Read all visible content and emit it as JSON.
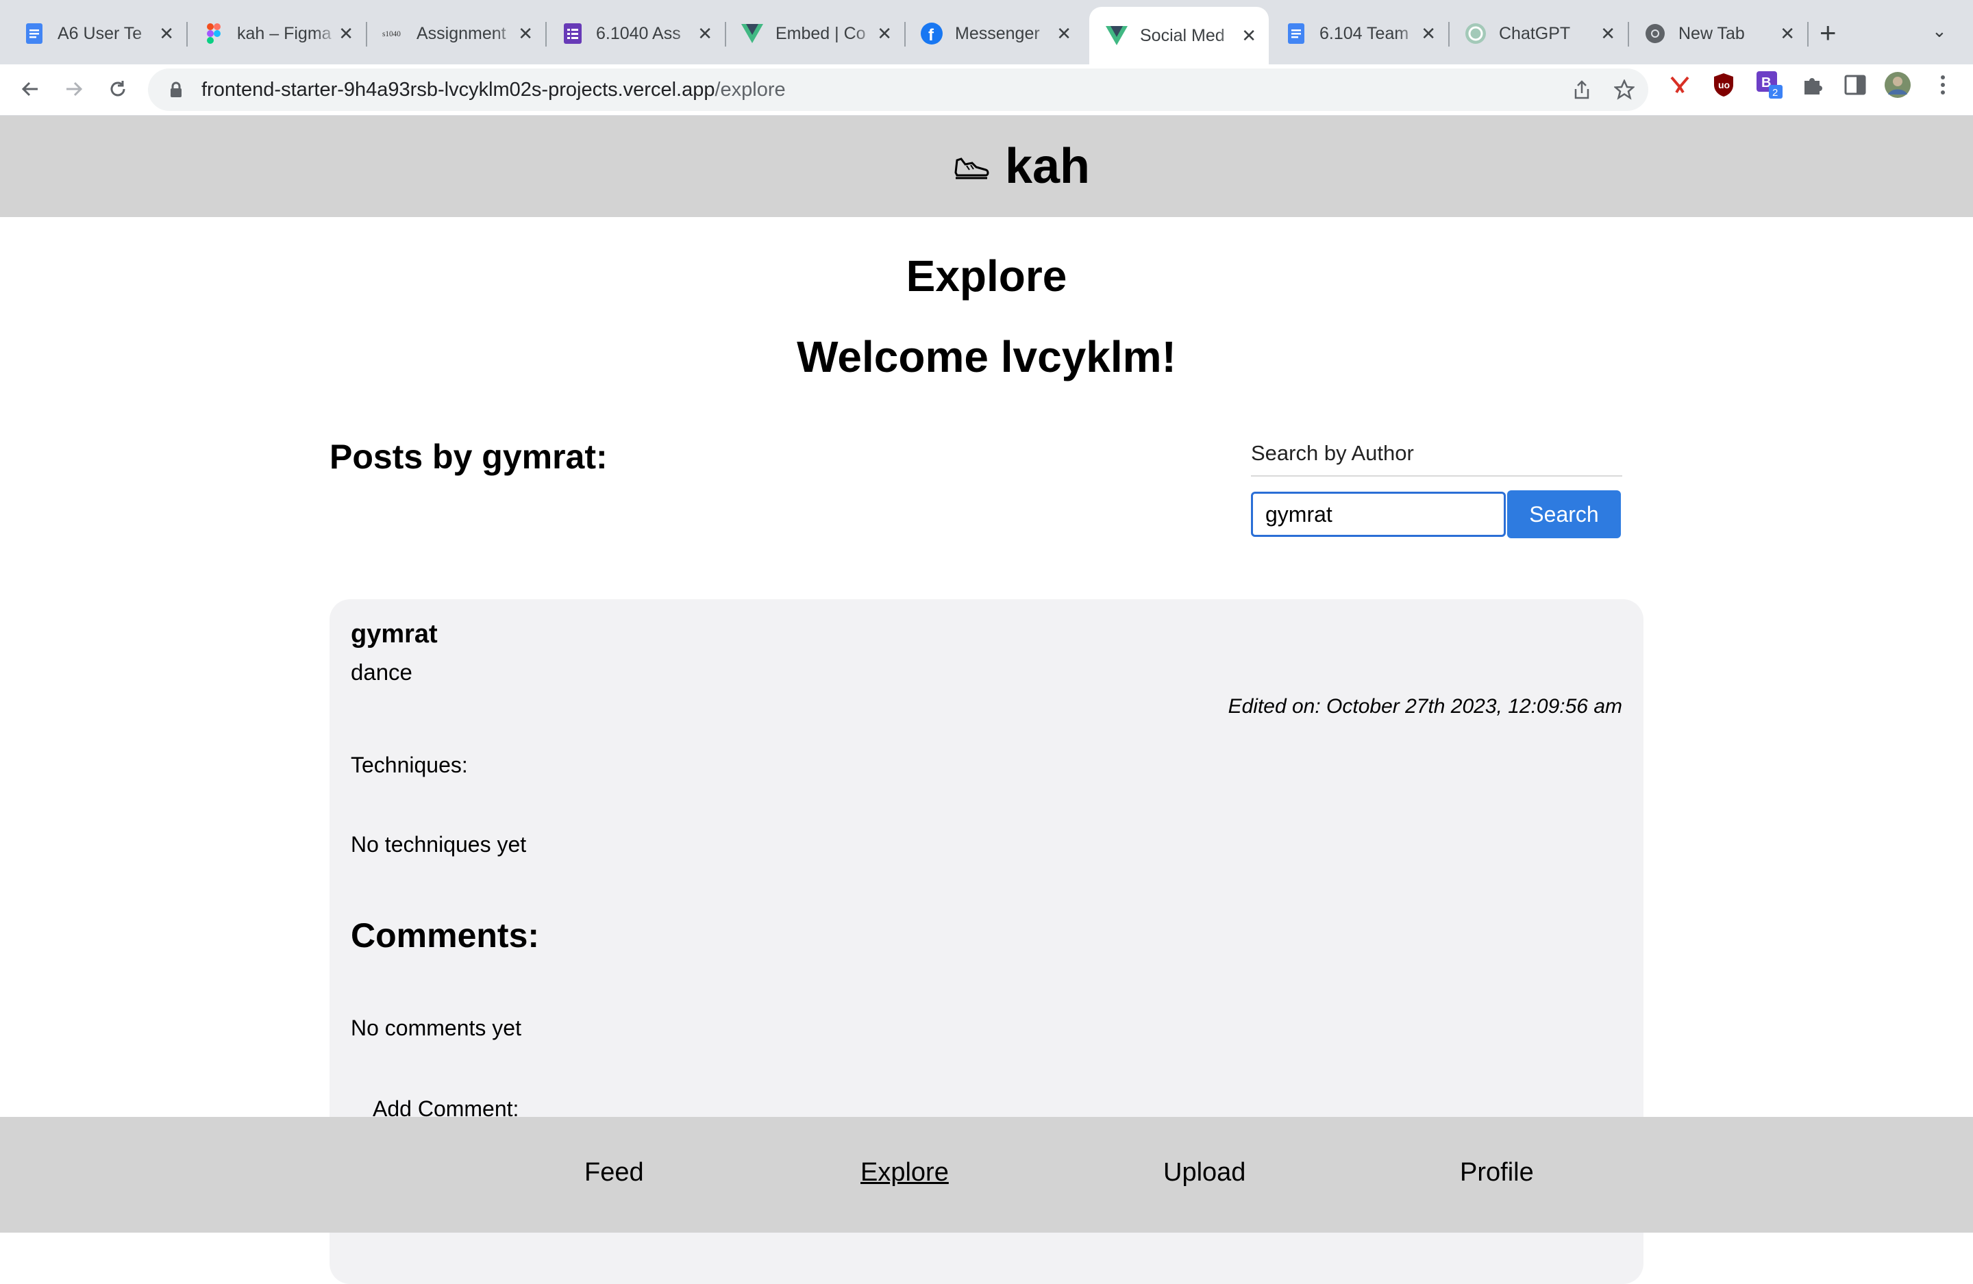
{
  "browser": {
    "tabs": [
      {
        "title": "A6 User Te",
        "icon": "google-docs-icon"
      },
      {
        "title": "kah – Figma",
        "icon": "figma-icon"
      },
      {
        "title": "Assignment",
        "icon": "61040-site-icon"
      },
      {
        "title": "6.1040 Ass",
        "icon": "google-forms-icon"
      },
      {
        "title": "Embed | Co",
        "icon": "vue-icon"
      },
      {
        "title": "Messenger",
        "icon": "facebook-icon"
      },
      {
        "title": "Social Med",
        "icon": "vue-icon",
        "active": true
      },
      {
        "title": "6.104 Team",
        "icon": "google-docs-icon"
      },
      {
        "title": "ChatGPT",
        "icon": "chatgpt-icon"
      },
      {
        "title": "New Tab",
        "icon": "chrome-icon"
      }
    ],
    "url_host": "frontend-starter-9h4a93rsb-lvcyklm02s-projects.vercel.app",
    "url_path": "/explore"
  },
  "app": {
    "brand_name": "kah",
    "brand_icon": "sneaker-icon"
  },
  "page": {
    "title": "Explore",
    "welcome": "Welcome lvcyklm!",
    "posts_heading": "Posts by gymrat:"
  },
  "search": {
    "label": "Search by Author",
    "value": "gymrat",
    "button_label": "Search"
  },
  "post": {
    "author": "gymrat",
    "content": "dance",
    "edited": "Edited on: October 27th 2023, 12:09:56 am",
    "techniques_label": "Techniques:",
    "techniques_empty": "No techniques yet",
    "comments_heading": "Comments:",
    "comments_empty": "No comments yet",
    "add_comment_label": "Add Comment:"
  },
  "nav": {
    "feed": "Feed",
    "explore": "Explore",
    "upload": "Upload",
    "profile": "Profile",
    "current": "Explore"
  },
  "colors": {
    "header_bg": "#d3d3d3",
    "accent_button": "#2e7be0",
    "card_bg": "#f2f2f4"
  }
}
